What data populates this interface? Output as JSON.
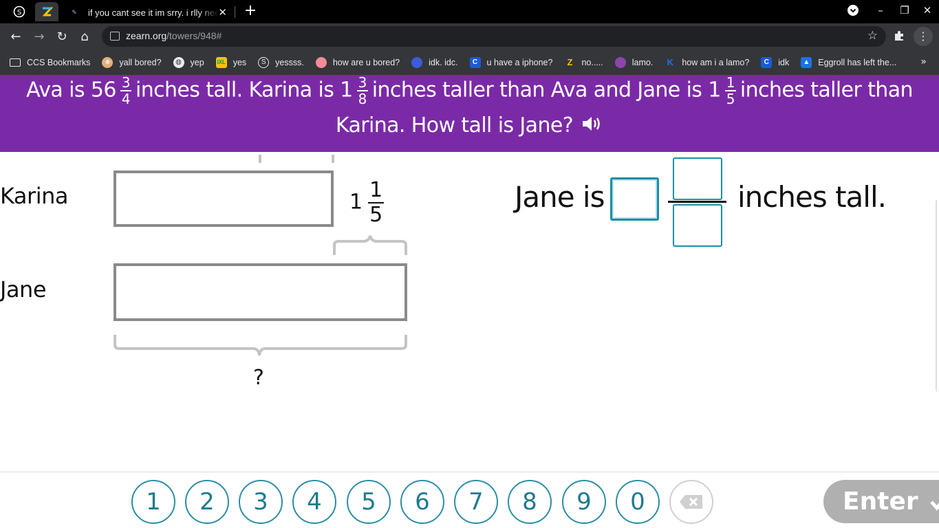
{
  "browser": {
    "tab_title": "if you cant see it im srry. i rlly need",
    "url_host": "zearn.org",
    "url_path": "/towers/948#",
    "bookmarks": [
      {
        "label": "CCS Bookmarks",
        "icon": "folder-icon"
      },
      {
        "label": "yall bored?",
        "icon": "face-icon"
      },
      {
        "label": "yep",
        "icon": "globe-icon"
      },
      {
        "label": "yes",
        "icon": "ixl-icon"
      },
      {
        "label": "yessss.",
        "icon": "s-circle-icon"
      },
      {
        "label": "how are u bored?",
        "icon": "pig-icon"
      },
      {
        "label": "idk. idc.",
        "icon": "ninja-icon"
      },
      {
        "label": "u have a iphone?",
        "icon": "c-icon"
      },
      {
        "label": "no.....",
        "icon": "z-icon"
      },
      {
        "label": "lamo.",
        "icon": "gem-icon"
      },
      {
        "label": "how am i a lamo?",
        "icon": "k-icon"
      },
      {
        "label": "idk",
        "icon": "c-icon"
      },
      {
        "label": "Eggroll has left the...",
        "icon": "classroom-icon"
      }
    ],
    "more_bookmarks": "»"
  },
  "problem": {
    "part1": "Ava is 56",
    "frac1": {
      "num": "3",
      "den": "4"
    },
    "part2": "inches tall. Karina is 1",
    "frac2": {
      "num": "3",
      "den": "8"
    },
    "part3": "inches taller than Ava and Jane is 1",
    "frac3": {
      "num": "1",
      "den": "5"
    },
    "part4": "inches taller than",
    "line2": "Karina. How tall is Jane?"
  },
  "diagram": {
    "label_karina": "Karina",
    "label_jane": "Jane",
    "diff_whole": "1",
    "diff_num": "1",
    "diff_den": "5",
    "question": "?"
  },
  "answer": {
    "prefix": "Jane is",
    "suffix": "inches tall."
  },
  "keypad": {
    "keys": [
      "1",
      "2",
      "3",
      "4",
      "5",
      "6",
      "7",
      "8",
      "9",
      "0"
    ],
    "enter_label": "Enter"
  },
  "colors": {
    "banner": "#7b2aa7",
    "accent": "#2a8ea4",
    "bar_border": "#8a8a8a"
  }
}
